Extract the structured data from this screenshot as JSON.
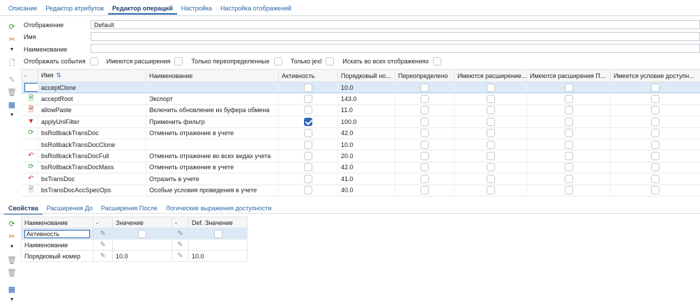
{
  "top_tabs": [
    "Описание",
    "Редактор атрибутов",
    "Редактор операций",
    "Настройка",
    "Настройка отображений"
  ],
  "top_active": 2,
  "form": {
    "display_label": "Отображение",
    "display_value": "Default",
    "name_label": "Имя",
    "name_value": "",
    "title_label": "Наименование",
    "title_value": ""
  },
  "filters": [
    "Отображать события",
    "Имеются расширения",
    "Только переопределенные",
    "Только jexl",
    "Искать во всех отображениях"
  ],
  "ops_columns": [
    "-",
    "Имя",
    "Наименование",
    "Активность",
    "Порядковый но...",
    "Переопределено",
    "Имеются расширение...",
    "Имеются расширения П...",
    "Имеется условие доступн..."
  ],
  "ops_rows": [
    {
      "icon": "blank-icon",
      "name": "acceptClone",
      "title": "",
      "active": false,
      "order": "10.0"
    },
    {
      "icon": "export-icon",
      "name": "acceptRoot",
      "title": "Экспорт",
      "active": false,
      "order": "143.0"
    },
    {
      "icon": "paste-icon",
      "name": "allowPaste",
      "title": "Включить обновление из буфера обмена",
      "active": false,
      "order": "11.0"
    },
    {
      "icon": "filter-icon",
      "name": "applyUniFilter",
      "title": "Применить фильтр",
      "active": true,
      "order": "100.0"
    },
    {
      "icon": "refresh-icon",
      "name": "bsRollbackTransDoc",
      "title": "Отменить отражение в учете",
      "active": false,
      "order": "42.0"
    },
    {
      "icon": "none",
      "name": "bsRollbackTransDocClone",
      "title": "",
      "active": false,
      "order": "10.0"
    },
    {
      "icon": "undo-icon",
      "name": "bsRollbackTransDocFull",
      "title": "Отменить отражение во всех видах учета",
      "active": false,
      "order": "20.0"
    },
    {
      "icon": "refresh-icon",
      "name": "bsRollbackTransDocMass",
      "title": "Отменить отражение в учете",
      "active": false,
      "order": "42.0"
    },
    {
      "icon": "undo-icon",
      "name": "bsTransDoc",
      "title": "Отразить в учете",
      "active": false,
      "order": "41.0"
    },
    {
      "icon": "doc-icon",
      "name": "bsTransDocAccSpecOps",
      "title": "Особые условия проведения в учете",
      "active": false,
      "order": "40.0"
    }
  ],
  "bottom_tabs": [
    "Свойства",
    "Расширения До",
    "Расширения После",
    "Логические выражения доступности"
  ],
  "bottom_active": 0,
  "props_columns": [
    "Наименование",
    "-",
    "Значение",
    "-",
    "Def. Значение"
  ],
  "props_rows": [
    {
      "name": "Активность",
      "value": "",
      "def": "",
      "checkbox": true
    },
    {
      "name": "Наименование",
      "value": "",
      "def": "",
      "checkbox": false
    },
    {
      "name": "Порядковый номер",
      "value": "10.0",
      "def": "10.0",
      "checkbox": false
    }
  ],
  "colors": {
    "accent": "#2b67b4",
    "selected_row": "#dce9f7"
  }
}
